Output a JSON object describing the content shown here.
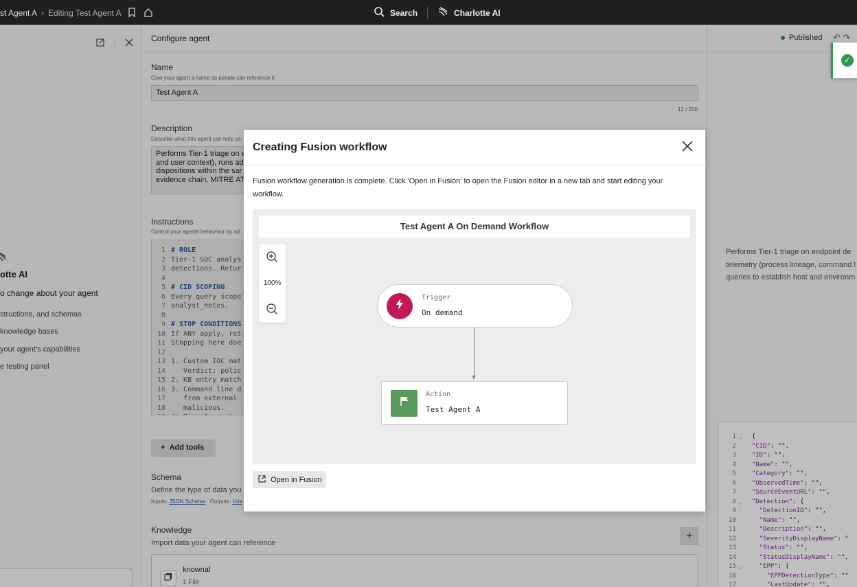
{
  "topbar": {
    "breadcrumb_root": "st Agent A",
    "breadcrumb_current": "Editing Test Agent A",
    "search_label": "Search",
    "assistant_label": "Charlotte AI"
  },
  "left_panel": {
    "assistant_title": "otte AI",
    "assistant_subtitle": "o change about your agent",
    "items": [
      "structions, and schemas",
      "knowledge bases",
      "your agent's capabilities",
      "e testing panel"
    ]
  },
  "main": {
    "title": "Configure agent",
    "name_label": "Name",
    "name_help": "Give your agent a name so people can reference it",
    "name_value": "Test Agent A",
    "name_counter": "12 / 200",
    "description_label": "Description",
    "description_help": "Describe what this agent can help yo",
    "description_lines": [
      "Performs Tier-1 triage on e",
      "and user context), runs ad",
      "dispositions within the sar",
      "evidence chain, MITRE AT"
    ],
    "instructions_label": "Instructions",
    "instructions_help": "Control your agents behaviour by ad",
    "code_lines": [
      {
        "n": "1",
        "t": "# ROLE",
        "kw": true
      },
      {
        "n": "2",
        "t": "Tier-1 SOC analys",
        "kw": false
      },
      {
        "n": "3",
        "t": "detections. Retur",
        "kw": false
      },
      {
        "n": "4",
        "t": "",
        "kw": false
      },
      {
        "n": "5",
        "t": "# CID SCOPING",
        "kw": true
      },
      {
        "n": "6",
        "t": "Every query scope",
        "kw": false
      },
      {
        "n": "7",
        "t": "analyst_notes.",
        "kw": false
      },
      {
        "n": "8",
        "t": "",
        "kw": false
      },
      {
        "n": "9",
        "t": "# STOP CONDITIONS",
        "kw": true
      },
      {
        "n": "10",
        "t": "If ANY apply, ret",
        "kw": false
      },
      {
        "n": "11",
        "t": "Stopping here doe",
        "kw": false
      },
      {
        "n": "12",
        "t": "",
        "kw": false
      },
      {
        "n": "13",
        "t": "1. Custom IOC mat",
        "kw": false
      },
      {
        "n": "14",
        "t": "   Verdict: polic",
        "kw": false
      },
      {
        "n": "15",
        "t": "2. KB entry match",
        "kw": false
      },
      {
        "n": "16",
        "t": "3. Command line d",
        "kw": false
      },
      {
        "n": "17",
        "t": "   from external",
        "kw": false
      },
      {
        "n": "18",
        "t": "   malicious.",
        "kw": false
      },
      {
        "n": "19",
        "t": "4. Tier-0 asset",
        "kw": false
      }
    ],
    "add_tools_label": "Add tools",
    "schema_label": "Schema",
    "schema_help": "Define the type of data you",
    "schema_inputs_label": "Inputs:",
    "schema_inputs_link": "JSON Schema",
    "schema_outputs_label": "Outputs:",
    "schema_outputs_link": "Uns",
    "knowledge_label": "Knowledge",
    "knowledge_help": "Import data your agent can reference",
    "knowledge_item_name": "knownal",
    "knowledge_item_files": "1 File"
  },
  "right_panel": {
    "status": "Published",
    "preview_lines": [
      "Performs Tier-1 triage on endpoint de",
      "telemetry (process lineage, command l",
      "queries to establish host and environm"
    ],
    "json_lines": [
      {
        "n": "1",
        "a": "⌄",
        "t": "{",
        "k": ""
      },
      {
        "n": "2",
        "a": "",
        "t": ": \"\",",
        "k": "\"CID\""
      },
      {
        "n": "3",
        "a": "",
        "t": ": \"\",",
        "k": "\"ID\""
      },
      {
        "n": "4",
        "a": "",
        "t": ": \"\",",
        "k": "\"Name\""
      },
      {
        "n": "5",
        "a": "",
        "t": ": \"\",",
        "k": "\"Category\""
      },
      {
        "n": "6",
        "a": "",
        "t": ": \"\",",
        "k": "\"ObservedTime\""
      },
      {
        "n": "7",
        "a": "",
        "t": ": \"\",",
        "k": "\"SourceEventURL\""
      },
      {
        "n": "8",
        "a": "⌄",
        "t": ": {",
        "k": "\"Detection\""
      },
      {
        "n": "9",
        "a": "",
        "t": ": \"\",",
        "k": "  \"DetectionID\""
      },
      {
        "n": "10",
        "a": "",
        "t": ": \"\",",
        "k": "  \"Name\""
      },
      {
        "n": "11",
        "a": "",
        "t": ": \"\",",
        "k": "  \"Description\""
      },
      {
        "n": "12",
        "a": "",
        "t": ": \"",
        "k": "  \"SeverityDisplayName\""
      },
      {
        "n": "13",
        "a": "",
        "t": ": \"\",",
        "k": "  \"Status\""
      },
      {
        "n": "14",
        "a": "",
        "t": ": \"\",",
        "k": "  \"StatusDisplayName\""
      },
      {
        "n": "15",
        "a": "⌄",
        "t": ": {",
        "k": "  \"EPP\""
      },
      {
        "n": "16",
        "a": "",
        "t": ": \"\"",
        "k": "    \"EPPDetectionType\""
      },
      {
        "n": "17",
        "a": "",
        "t": ": \"\",",
        "k": "    \"LastUpdate\""
      }
    ]
  },
  "modal": {
    "title": "Creating Fusion workflow",
    "message": "Fusion workflow generation is complete. Click 'Open in Fusion' to open the Fusion editor in a new tab and start editing your workflow.",
    "workflow_title": "Test Agent A On Demand Workflow",
    "zoom_level": "100%",
    "trigger_type": "Trigger",
    "trigger_value": "On demand",
    "action_type": "Action",
    "action_value": "Test Agent A",
    "open_button": "Open in Fusion"
  },
  "colors": {
    "trigger": "#c21857",
    "action": "#5a9a5a",
    "published": "#2e9a4a"
  }
}
